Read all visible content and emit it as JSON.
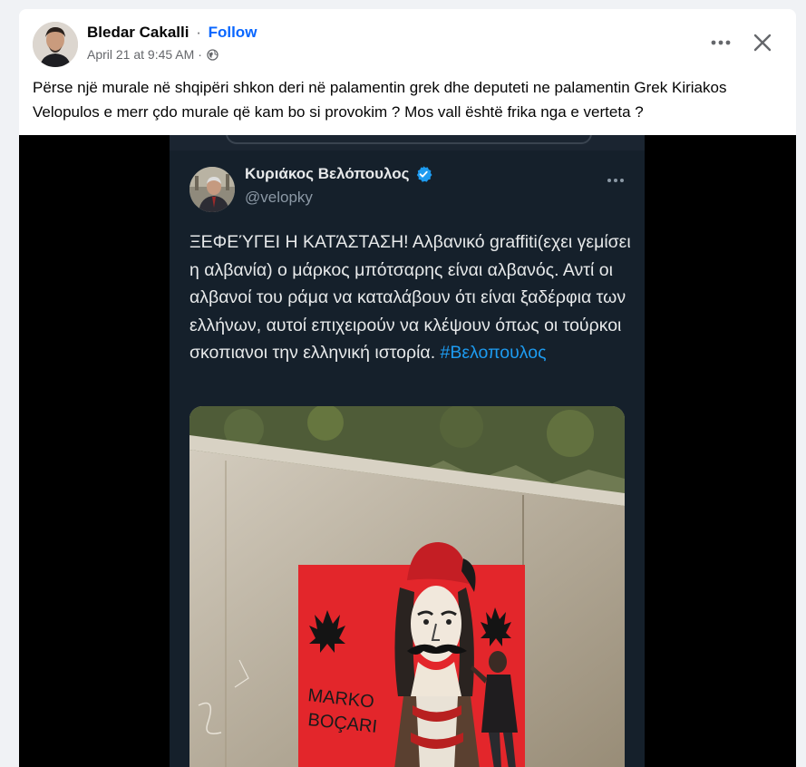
{
  "post": {
    "author": "Bledar Cakalli",
    "separator": "·",
    "follow_label": "Follow",
    "timestamp": "April 21 at 9:45 AM",
    "timestamp_separator": "·",
    "text": "Përse një murale në shqipëri shkon deri në palamentin grek dhe deputeti ne palamentin Grek Kiriakos Velopulos e merr çdo murale që kam bo si provokim ? Mos vall është frika nga e verteta ?"
  },
  "tweet": {
    "display_name": "Κυριάκος Βελόπουλος",
    "handle": "@velopky",
    "body": "ΞΕΦΕΎΓΕΙ Η ΚΑΤΆΣΤΑΣΗ! Αλβανικό graffiti(εχει γεμίσει η αλβανία) ο μάρκος μπότσαρης είναι αλβανός. Αντί οι αλβανοί του ράμα να καταλάβουν ότι είναι ξαδέρφια των ελλήνων, αυτοί επιχειρούν να κλέψουν όπως οι τούρκοι σκοπιανοι την ελληνική ιστορία.",
    "hashtag": "#Βελοπουλος"
  },
  "mural": {
    "text_line1": "MARKO",
    "text_line2": "BOÇARI"
  },
  "colors": {
    "facebook_blue": "#0866ff",
    "twitter_blue": "#1d9bf0",
    "tweet_background": "#15202b",
    "albanian_red": "#e3262b"
  },
  "icons": {
    "more": "more-horizontal-icon",
    "close": "close-icon",
    "audience": "globe-icon",
    "verified": "verified-badge-icon"
  }
}
